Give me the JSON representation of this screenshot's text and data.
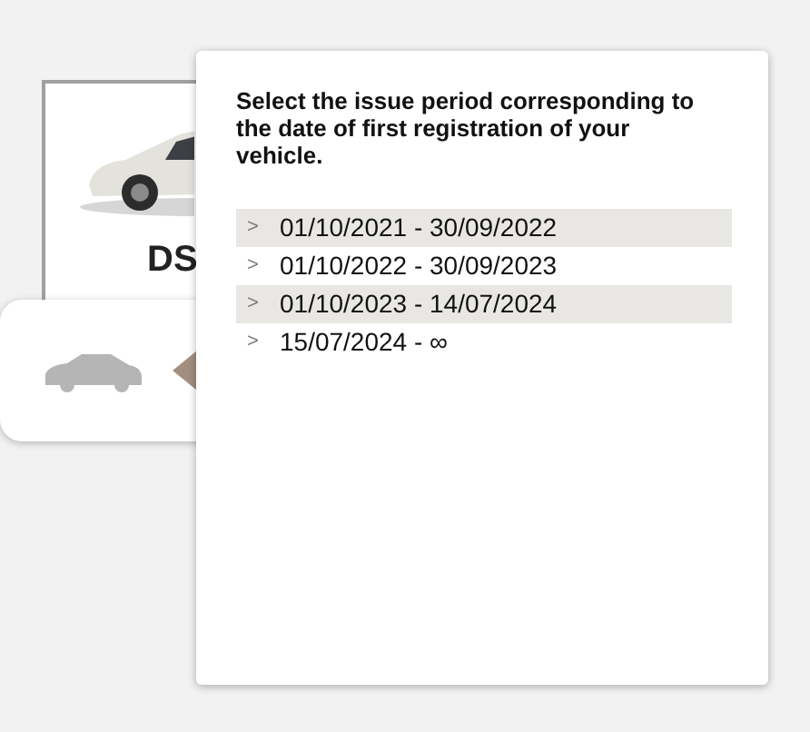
{
  "model_card": {
    "name": "DS"
  },
  "popup": {
    "heading": "Select the issue period corresponding to the date of first registration of your vehicle.",
    "periods": [
      {
        "chevron": ">",
        "label": "01/10/2021 - 30/09/2022"
      },
      {
        "chevron": ">",
        "label": "01/10/2022 - 30/09/2023"
      },
      {
        "chevron": ">",
        "label": "01/10/2023 - 14/07/2024"
      },
      {
        "chevron": ">",
        "label": "15/07/2024 - ∞"
      }
    ]
  }
}
